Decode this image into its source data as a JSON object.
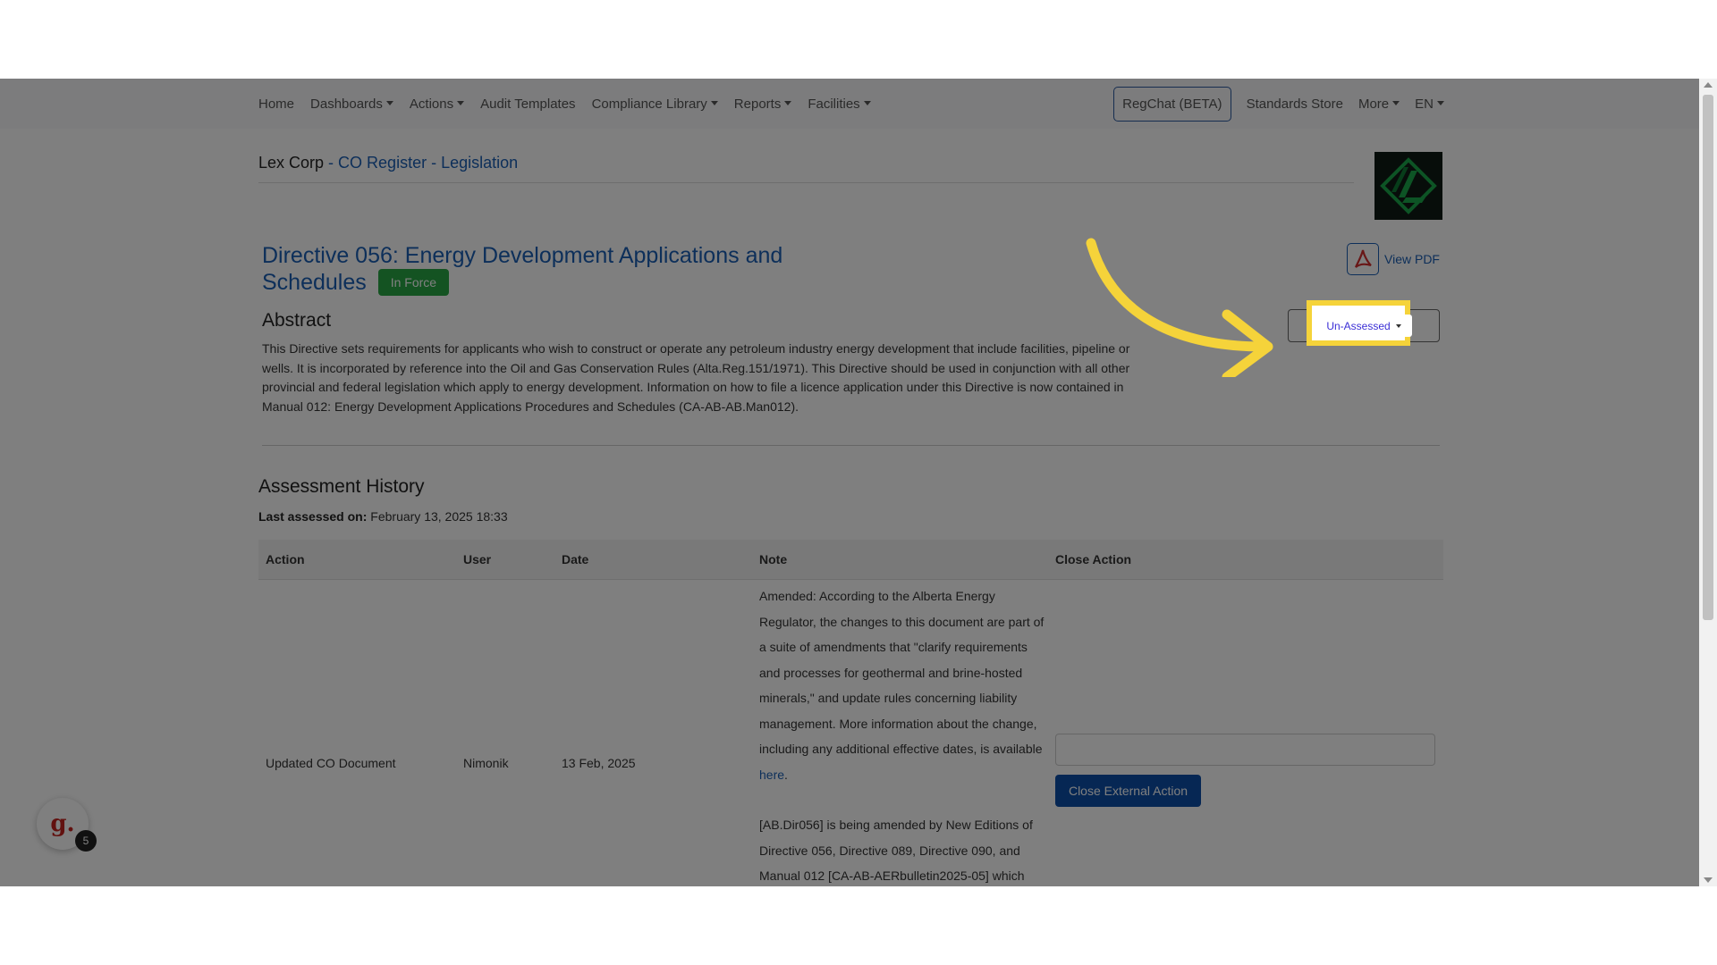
{
  "nav": {
    "items": [
      {
        "label": "Home",
        "dropdown": false
      },
      {
        "label": "Dashboards",
        "dropdown": true
      },
      {
        "label": "Actions",
        "dropdown": true
      },
      {
        "label": "Audit Templates",
        "dropdown": false
      },
      {
        "label": "Compliance Library",
        "dropdown": true
      },
      {
        "label": "Reports",
        "dropdown": true
      },
      {
        "label": "Facilities",
        "dropdown": true
      }
    ],
    "regchat": "RegChat (BETA)",
    "standards_store": "Standards Store",
    "more": "More",
    "lang": "EN"
  },
  "breadcrumb": {
    "company": "Lex Corp",
    "separator": " - ",
    "register": "CO Register - Legislation"
  },
  "document": {
    "title": "Directive 056: Energy Development Applications and Schedules",
    "status_badge": "In Force",
    "abstract_heading": "Abstract",
    "abstract": "This Directive sets requirements for applicants who wish to construct or operate any petroleum industry energy development that include facilities, pipeline or wells. It is incorporated by reference into the Oil and Gas Conservation Rules (Alta.Reg.151/1971). This Directive should be used in conjunction with all other provincial and federal legislation which apply to energy development. Information on how to file a licence application under this Directive is now contained in Manual 012: Energy Development Applications Procedures and Schedules (CA-AB-AB.Man012).",
    "view_pdf": "View PDF",
    "assessment_status": "Un-Assessed"
  },
  "history": {
    "heading": "Assessment History",
    "last_assessed_label": "Last assessed on:",
    "last_assessed_value": "February 13, 2025 18:33",
    "columns": [
      "Action",
      "User",
      "Date",
      "Note",
      "Close Action"
    ],
    "rows": [
      {
        "action": "Updated CO Document",
        "user": "Nimonik",
        "date": "13 Feb, 2025",
        "note_p1": "Amended: According to the Alberta Energy Regulator, the changes to this document are part of a suite of amendments that \"clarify requirements and processes for geothermal and brine-hosted minerals,\" and update rules concerning liability management. More information about the change, including any additional effective dates, is available",
        "note_link": "here",
        "note_p2": "[AB.Dir056] is being amended by New Editions of Directive 056, Directive 089, Directive 090, and Manual 012 [CA-AB-AERbulletin2025-05] which",
        "close_button": "Close External Action"
      }
    ]
  },
  "widget": {
    "letter": "g.",
    "count": "5"
  },
  "colors": {
    "link": "#1a5fb4",
    "badge_green": "#28a745",
    "highlight_yellow": "#f5d33a",
    "primary_button": "#0d4fa8"
  }
}
